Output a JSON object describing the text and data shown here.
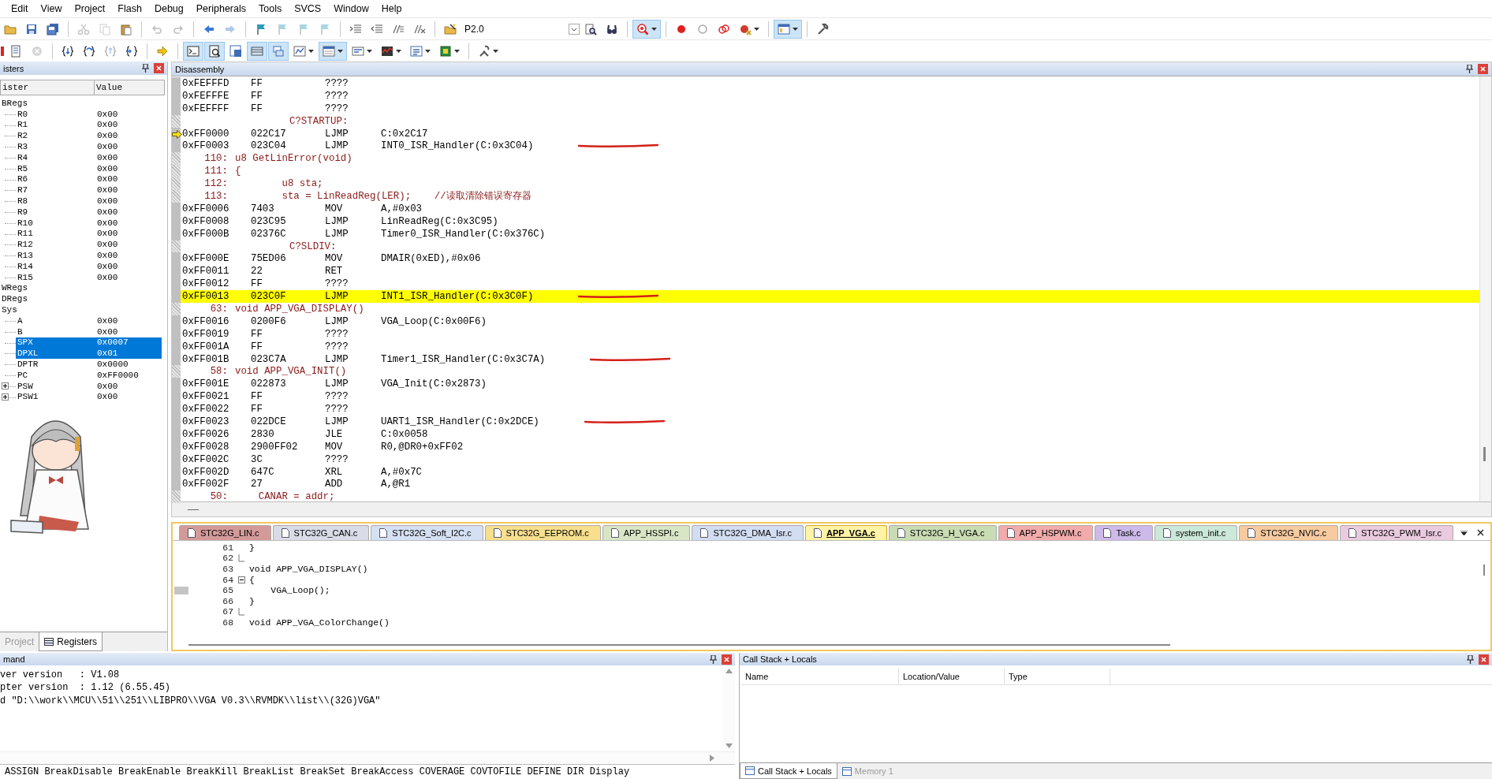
{
  "menu": [
    "Edit",
    "View",
    "Project",
    "Flash",
    "Debug",
    "Peripherals",
    "Tools",
    "SVCS",
    "Window",
    "Help"
  ],
  "toolbar_1": [
    {
      "kind": "button",
      "disabled": false,
      "pressed": false,
      "menu": false
    },
    {
      "kind": "button",
      "disabled": false,
      "pressed": false,
      "menu": false
    },
    {
      "kind": "button",
      "disabled": false,
      "pressed": false,
      "menu": false
    },
    {
      "kind": "separator"
    },
    {
      "kind": "button",
      "disabled": true,
      "pressed": false,
      "menu": false
    },
    {
      "kind": "button",
      "disabled": true,
      "pressed": false,
      "menu": false
    },
    {
      "kind": "button",
      "disabled": false,
      "pressed": false,
      "menu": false
    },
    {
      "kind": "separator"
    },
    {
      "kind": "button",
      "disabled": true,
      "pressed": false,
      "menu": false
    },
    {
      "kind": "button",
      "disabled": true,
      "pressed": false,
      "menu": false
    },
    {
      "kind": "separator"
    },
    {
      "kind": "button",
      "disabled": false,
      "pressed": false,
      "menu": false
    },
    {
      "kind": "button",
      "disabled": true,
      "pressed": false,
      "menu": false
    },
    {
      "kind": "separator"
    },
    {
      "kind": "button",
      "disabled": false,
      "pressed": false,
      "menu": false
    },
    {
      "kind": "button",
      "disabled": true,
      "pressed": false,
      "menu": false
    },
    {
      "kind": "button",
      "disabled": true,
      "pressed": false,
      "menu": false
    },
    {
      "kind": "button",
      "disabled": true,
      "pressed": false,
      "menu": false
    },
    {
      "kind": "separator"
    },
    {
      "kind": "button",
      "disabled": false,
      "pressed": false,
      "menu": false
    },
    {
      "kind": "button",
      "disabled": false,
      "pressed": false,
      "menu": false
    },
    {
      "kind": "button",
      "disabled": false,
      "pressed": false,
      "menu": false
    },
    {
      "kind": "button",
      "disabled": false,
      "pressed": false,
      "menu": false
    },
    {
      "kind": "separator"
    },
    {
      "kind": "button",
      "disabled": false,
      "pressed": false,
      "menu": false
    },
    {
      "kind": "combo",
      "value": "P2.0"
    },
    {
      "kind": "button",
      "disabled": false,
      "pressed": false,
      "menu": false
    },
    {
      "kind": "button",
      "disabled": false,
      "pressed": false,
      "menu": false
    },
    {
      "kind": "separator"
    },
    {
      "kind": "button",
      "disabled": false,
      "pressed": true,
      "menu": true
    },
    {
      "kind": "separator"
    },
    {
      "kind": "button",
      "disabled": false,
      "pressed": false,
      "menu": false
    },
    {
      "kind": "button",
      "disabled": false,
      "pressed": false,
      "menu": false
    },
    {
      "kind": "button",
      "disabled": false,
      "pressed": false,
      "menu": false
    },
    {
      "kind": "button",
      "disabled": false,
      "pressed": false,
      "menu": true
    },
    {
      "kind": "separator"
    },
    {
      "kind": "button",
      "disabled": false,
      "pressed": true,
      "menu": true
    },
    {
      "kind": "separator"
    },
    {
      "kind": "button",
      "disabled": false,
      "pressed": false,
      "menu": false
    }
  ],
  "toolbar_2": [
    {
      "kind": "button",
      "disabled": false,
      "pressed": false,
      "menu": false
    },
    {
      "kind": "button",
      "disabled": false,
      "pressed": false,
      "menu": false
    },
    {
      "kind": "button",
      "disabled": true,
      "pressed": false,
      "menu": false
    },
    {
      "kind": "separator"
    },
    {
      "kind": "button",
      "disabled": false,
      "pressed": false,
      "menu": false
    },
    {
      "kind": "button",
      "disabled": false,
      "pressed": false,
      "menu": false
    },
    {
      "kind": "button",
      "disabled": true,
      "pressed": false,
      "menu": false
    },
    {
      "kind": "button",
      "disabled": false,
      "pressed": false,
      "menu": false
    },
    {
      "kind": "separator"
    },
    {
      "kind": "button",
      "disabled": false,
      "pressed": false,
      "menu": false
    },
    {
      "kind": "separator"
    },
    {
      "kind": "button",
      "disabled": false,
      "pressed": true,
      "menu": false
    },
    {
      "kind": "button",
      "disabled": false,
      "pressed": true,
      "menu": false
    },
    {
      "kind": "button",
      "disabled": false,
      "pressed": false,
      "menu": false
    },
    {
      "kind": "button",
      "disabled": false,
      "pressed": true,
      "menu": false
    },
    {
      "kind": "button",
      "disabled": false,
      "pressed": true,
      "menu": false
    },
    {
      "kind": "button",
      "disabled": false,
      "pressed": false,
      "menu": true
    },
    {
      "kind": "button",
      "disabled": false,
      "pressed": true,
      "menu": true
    },
    {
      "kind": "button",
      "disabled": false,
      "pressed": false,
      "menu": true
    },
    {
      "kind": "button",
      "disabled": false,
      "pressed": false,
      "menu": true
    },
    {
      "kind": "button",
      "disabled": false,
      "pressed": false,
      "menu": true
    },
    {
      "kind": "button",
      "disabled": false,
      "pressed": false,
      "menu": true
    },
    {
      "kind": "separator"
    },
    {
      "kind": "button",
      "disabled": false,
      "pressed": false,
      "menu": true
    }
  ],
  "registers": {
    "title": "isters",
    "columns": [
      "ister",
      "Value"
    ],
    "tree": [
      {
        "name": "BRegs",
        "selected": false,
        "children": [
          {
            "name": "R0",
            "value": "0x00",
            "selected": false
          },
          {
            "name": "R1",
            "value": "0x00",
            "selected": false
          },
          {
            "name": "R2",
            "value": "0x00",
            "selected": false
          },
          {
            "name": "R3",
            "value": "0x00",
            "selected": false
          },
          {
            "name": "R4",
            "value": "0x00",
            "selected": false
          },
          {
            "name": "R5",
            "value": "0x00",
            "selected": false
          },
          {
            "name": "R6",
            "value": "0x00",
            "selected": false
          },
          {
            "name": "R7",
            "value": "0x00",
            "selected": false
          },
          {
            "name": "R8",
            "value": "0x00",
            "selected": false
          },
          {
            "name": "R9",
            "value": "0x00",
            "selected": false
          },
          {
            "name": "R10",
            "value": "0x00",
            "selected": false
          },
          {
            "name": "R11",
            "value": "0x00",
            "selected": false
          },
          {
            "name": "R12",
            "value": "0x00",
            "selected": false
          },
          {
            "name": "R13",
            "value": "0x00",
            "selected": false
          },
          {
            "name": "R14",
            "value": "0x00",
            "selected": false
          },
          {
            "name": "R15",
            "value": "0x00",
            "selected": false
          }
        ]
      },
      {
        "name": "WRegs",
        "selected": false
      },
      {
        "name": "DRegs",
        "selected": false
      },
      {
        "name": "Sys",
        "selected": false,
        "children": [
          {
            "name": "A",
            "value": "0x00",
            "selected": false
          },
          {
            "name": "B",
            "value": "0x00",
            "selected": false
          },
          {
            "name": "SPX",
            "value": "0x0007",
            "selected": true
          },
          {
            "name": "DPXL",
            "value": "0x01",
            "selected": true
          },
          {
            "name": "DPTR",
            "value": "0x0000",
            "selected": false
          },
          {
            "name": "PC",
            "value": "0xFF0000",
            "selected": false
          },
          {
            "name": "PSW",
            "value": "0x00",
            "selected": false,
            "expanded": false
          },
          {
            "name": "PSW1",
            "value": "0x00",
            "selected": false,
            "expanded": false
          }
        ]
      }
    ]
  },
  "left_tabs": [
    {
      "label": "Project",
      "selected": false
    },
    {
      "label": "Registers",
      "selected": true
    }
  ],
  "disassembly": {
    "title": "Disassembly",
    "rows": [
      {
        "kind": "asm",
        "address": "0xFEFFFD",
        "bytes": "FF",
        "mnemonic": "????",
        "selected": false,
        "current": false,
        "underlined": false
      },
      {
        "kind": "asm",
        "address": "0xFEFFFE",
        "bytes": "FF",
        "mnemonic": "????",
        "selected": false,
        "current": false,
        "underlined": false
      },
      {
        "kind": "asm",
        "address": "0xFEFFFF",
        "bytes": "FF",
        "mnemonic": "????",
        "selected": false,
        "current": false,
        "underlined": false
      },
      {
        "kind": "label",
        "text": "C?STARTUP:",
        "selected": false
      },
      {
        "kind": "asm",
        "address": "0xFF0000",
        "bytes": "022C17",
        "mnemonic": "LJMP",
        "operand": "C:0x2C17",
        "selected": false,
        "current": true,
        "underlined": false
      },
      {
        "kind": "asm",
        "address": "0xFF0003",
        "bytes": "023C04",
        "mnemonic": "LJMP",
        "operand": "INT0_ISR_Handler(C:0x3C04)",
        "selected": false,
        "current": false,
        "underlined": true
      },
      {
        "kind": "source",
        "line": "110:",
        "code": "u8 GetLinError(void)",
        "selected": false
      },
      {
        "kind": "source",
        "line": "111:",
        "code": "{",
        "selected": false
      },
      {
        "kind": "source",
        "line": "112:",
        "code": "        u8 sta;",
        "selected": false
      },
      {
        "kind": "source",
        "line": "113:",
        "code": "        sta = LinReadReg(LER);    //读取清除错误寄存器",
        "selected": false
      },
      {
        "kind": "asm",
        "address": "0xFF0006",
        "bytes": "7403",
        "mnemonic": "MOV",
        "operand": "A,#0x03",
        "selected": false,
        "current": false,
        "underlined": false
      },
      {
        "kind": "asm",
        "address": "0xFF0008",
        "bytes": "023C95",
        "mnemonic": "LJMP",
        "operand": "LinReadReg(C:0x3C95)",
        "selected": false,
        "current": false,
        "underlined": false
      },
      {
        "kind": "asm",
        "address": "0xFF000B",
        "bytes": "02376C",
        "mnemonic": "LJMP",
        "operand": "Timer0_ISR_Handler(C:0x376C)",
        "selected": false,
        "current": false,
        "underlined": false
      },
      {
        "kind": "label",
        "text": "C?SLDIV:",
        "selected": false
      },
      {
        "kind": "asm",
        "address": "0xFF000E",
        "bytes": "75ED06",
        "mnemonic": "MOV",
        "operand": "DMAIR(0xED),#0x06",
        "selected": false,
        "current": false,
        "underlined": false
      },
      {
        "kind": "asm",
        "address": "0xFF0011",
        "bytes": "22",
        "mnemonic": "RET",
        "selected": false,
        "current": false,
        "underlined": false
      },
      {
        "kind": "asm",
        "address": "0xFF0012",
        "bytes": "FF",
        "mnemonic": "????",
        "selected": false,
        "current": false,
        "underlined": false
      },
      {
        "kind": "asm",
        "address": "0xFF0013",
        "bytes": "023C0F",
        "mnemonic": "LJMP",
        "operand": "INT1_ISR_Handler(C:0x3C0F)",
        "selected": true,
        "current": false,
        "underlined": true
      },
      {
        "kind": "source",
        "line": "63:",
        "code": "void APP_VGA_DISPLAY()",
        "selected": false
      },
      {
        "kind": "asm",
        "address": "0xFF0016",
        "bytes": "0200F6",
        "mnemonic": "LJMP",
        "operand": "VGA_Loop(C:0x00F6)",
        "selected": false,
        "current": false,
        "underlined": false
      },
      {
        "kind": "asm",
        "address": "0xFF0019",
        "bytes": "FF",
        "mnemonic": "????",
        "selected": false,
        "current": false,
        "underlined": false
      },
      {
        "kind": "asm",
        "address": "0xFF001A",
        "bytes": "FF",
        "mnemonic": "????",
        "selected": false,
        "current": false,
        "underlined": false
      },
      {
        "kind": "asm",
        "address": "0xFF001B",
        "bytes": "023C7A",
        "mnemonic": "LJMP",
        "operand": "Timer1_ISR_Handler(C:0x3C7A)",
        "selected": false,
        "current": false,
        "underlined": true
      },
      {
        "kind": "source",
        "line": "58:",
        "code": "void APP_VGA_INIT()",
        "selected": false
      },
      {
        "kind": "asm",
        "address": "0xFF001E",
        "bytes": "022873",
        "mnemonic": "LJMP",
        "operand": "VGA_Init(C:0x2873)",
        "selected": false,
        "current": false,
        "underlined": false
      },
      {
        "kind": "asm",
        "address": "0xFF0021",
        "bytes": "FF",
        "mnemonic": "????",
        "selected": false,
        "current": false,
        "underlined": false
      },
      {
        "kind": "asm",
        "address": "0xFF0022",
        "bytes": "FF",
        "mnemonic": "????",
        "selected": false,
        "current": false,
        "underlined": false
      },
      {
        "kind": "asm",
        "address": "0xFF0023",
        "bytes": "022DCE",
        "mnemonic": "LJMP",
        "operand": "UART1_ISR_Handler(C:0x2DCE)",
        "selected": false,
        "current": false,
        "underlined": true
      },
      {
        "kind": "asm",
        "address": "0xFF0026",
        "bytes": "2830",
        "mnemonic": "JLE",
        "operand": "C:0x0058",
        "selected": false,
        "current": false,
        "underlined": false
      },
      {
        "kind": "asm",
        "address": "0xFF0028",
        "bytes": "2900FF02",
        "mnemonic": "MOV",
        "operand": "R0,@DR0+0xFF02",
        "selected": false,
        "current": false,
        "underlined": false
      },
      {
        "kind": "asm",
        "address": "0xFF002C",
        "bytes": "3C",
        "mnemonic": "????",
        "selected": false,
        "current": false,
        "underlined": false
      },
      {
        "kind": "asm",
        "address": "0xFF002D",
        "bytes": "647C",
        "mnemonic": "XRL",
        "operand": "A,#0x7C",
        "selected": false,
        "current": false,
        "underlined": false
      },
      {
        "kind": "asm",
        "address": "0xFF002F",
        "bytes": "27",
        "mnemonic": "ADD",
        "operand": "A,@R1",
        "selected": false,
        "current": false,
        "underlined": false
      },
      {
        "kind": "source",
        "line": "50:",
        "code": "    CANAR = addr;",
        "selected": false
      }
    ]
  },
  "editor": {
    "tabs": [
      {
        "label": "STC32G_LIN.c",
        "color": "#d49a9a",
        "selected": false
      },
      {
        "label": "STC32G_CAN.c",
        "color": "#d9dbe6",
        "selected": false
      },
      {
        "label": "STC32G_Soft_I2C.c",
        "color": "#d5e0f3",
        "selected": false
      },
      {
        "label": "STC32G_EEPROM.c",
        "color": "#f7df8e",
        "selected": false
      },
      {
        "label": "APP_HSSPI.c",
        "color": "#d9e6c6",
        "selected": false
      },
      {
        "label": "STC32G_DMA_Isr.c",
        "color": "#d2ddf2",
        "selected": false
      },
      {
        "label": "APP_VGA.c",
        "color": "#fff3a6",
        "selected": true
      },
      {
        "label": "STC32G_H_VGA.c",
        "color": "#c9dcb3",
        "selected": false
      },
      {
        "label": "APP_HSPWM.c",
        "color": "#f2abab",
        "selected": false
      },
      {
        "label": "Task.c",
        "color": "#cdb9ea",
        "selected": false
      },
      {
        "label": "system_init.c",
        "color": "#cbe8d8",
        "selected": false
      },
      {
        "label": "STC32G_NVIC.c",
        "color": "#f7caa0",
        "selected": false
      },
      {
        "label": "STC32G_PWM_Isr.c",
        "color": "#e9cade",
        "selected": false
      }
    ],
    "lines": [
      {
        "number": "61",
        "code": "}",
        "marked": false,
        "fold_start": false,
        "fold_end": false
      },
      {
        "number": "62",
        "marked": false,
        "fold_start": false,
        "fold_end": true
      },
      {
        "number": "63",
        "code": "void APP_VGA_DISPLAY()",
        "marked": false,
        "fold_start": false,
        "fold_end": false
      },
      {
        "number": "64",
        "code": "{",
        "marked": false,
        "fold_start": true,
        "fold_end": false
      },
      {
        "number": "65",
        "code": "    VGA_Loop();",
        "marked": true,
        "fold_start": false,
        "fold_end": false
      },
      {
        "number": "66",
        "code": "}",
        "marked": false,
        "fold_start": false,
        "fold_end": false
      },
      {
        "number": "67",
        "marked": false,
        "fold_start": false,
        "fold_end": true
      },
      {
        "number": "68",
        "code": "void APP_VGA_ColorChange()",
        "marked": false,
        "fold_start": false,
        "fold_end": false
      }
    ]
  },
  "command": {
    "title": "mand",
    "lines": [
      "ver version   : V1.08",
      "pter version  : 1.12 (6.55.45)",
      "d \"D:\\\\work\\\\MCU\\\\51\\\\251\\\\LIBPRO\\\\VGA V0.3\\\\RVMDK\\\\list\\\\(32G)VGA\""
    ],
    "help": "ASSIGN BreakDisable BreakEnable BreakKill BreakList BreakSet BreakAccess COVERAGE COVTOFILE DEFINE DIR Display"
  },
  "call_stack": {
    "title": "Call Stack + Locals",
    "columns": [
      "Name",
      "Location/Value",
      "Type"
    ],
    "tabs": [
      {
        "label": "Call Stack + Locals",
        "selected": true
      },
      {
        "label": "Memory 1",
        "selected": false
      }
    ]
  }
}
